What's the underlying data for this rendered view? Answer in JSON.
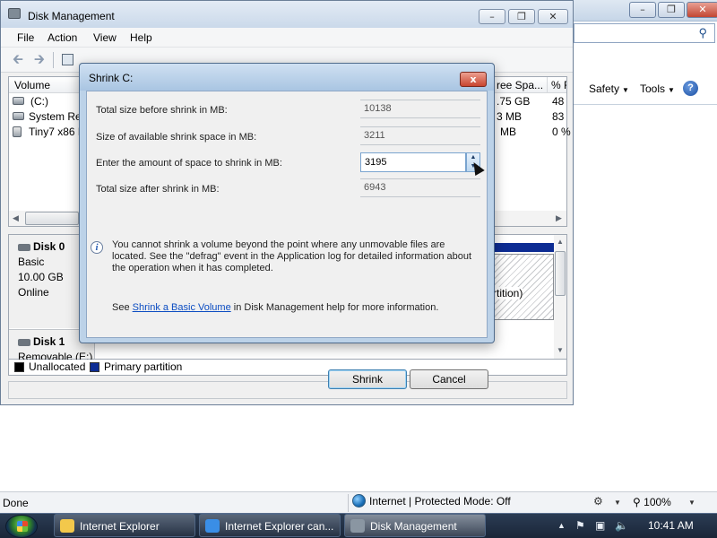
{
  "ie": {
    "status_text": "Done",
    "zone_text": "Internet | Protected Mode: Off",
    "zoom_text": "100%",
    "commands": [
      "Safety",
      "Tools"
    ]
  },
  "dm": {
    "title": "Disk Management",
    "menu": [
      "File",
      "Action",
      "View",
      "Help"
    ],
    "columns": [
      "Volume",
      "ree Spa...",
      "% F"
    ],
    "volumes": [
      {
        "name": "(C:)",
        "free": ".75 GB",
        "pct": "48"
      },
      {
        "name": "System Res",
        "free": "3 MB",
        "pct": "83"
      },
      {
        "name": "Tiny7 x86 R",
        "free": "MB",
        "pct": "0 %"
      }
    ],
    "disks": [
      {
        "name": "Disk 0",
        "lines": [
          "Basic",
          "10.00 GB",
          "Online"
        ]
      },
      {
        "name": "Disk 1",
        "lines": [
          "Removable (E:)"
        ]
      }
    ],
    "partition_text": "rtition)",
    "legend": [
      "Unallocated",
      "Primary partition"
    ]
  },
  "dialog": {
    "title": "Shrink C:",
    "close_glyph": "x",
    "fields": [
      {
        "label": "Total size before shrink in MB:",
        "value": "10138"
      },
      {
        "label": "Size of available shrink space in MB:",
        "value": "3211"
      },
      {
        "label": "Enter the amount of space to shrink in MB:",
        "value": "3195"
      },
      {
        "label": "Total size after shrink in MB:",
        "value": "6943"
      }
    ],
    "info_text": "You cannot shrink a volume beyond the point where any unmovable files are located. See the \"defrag\" event in the Application log for detailed information about the operation when it has completed.",
    "see_prefix": "See ",
    "see_link": "Shrink a Basic Volume",
    "see_suffix": " in Disk Management help for more information.",
    "shrink_label": "Shrink",
    "cancel_label": "Cancel"
  },
  "taskbar": {
    "tasks": [
      "Internet Explorer",
      "Internet Explorer can...",
      "Disk Management"
    ],
    "time": "10:41 AM"
  },
  "colors": {
    "unallocated": "#000000",
    "primary_partition": "#0d2c93",
    "link": "#0b4cc2"
  }
}
